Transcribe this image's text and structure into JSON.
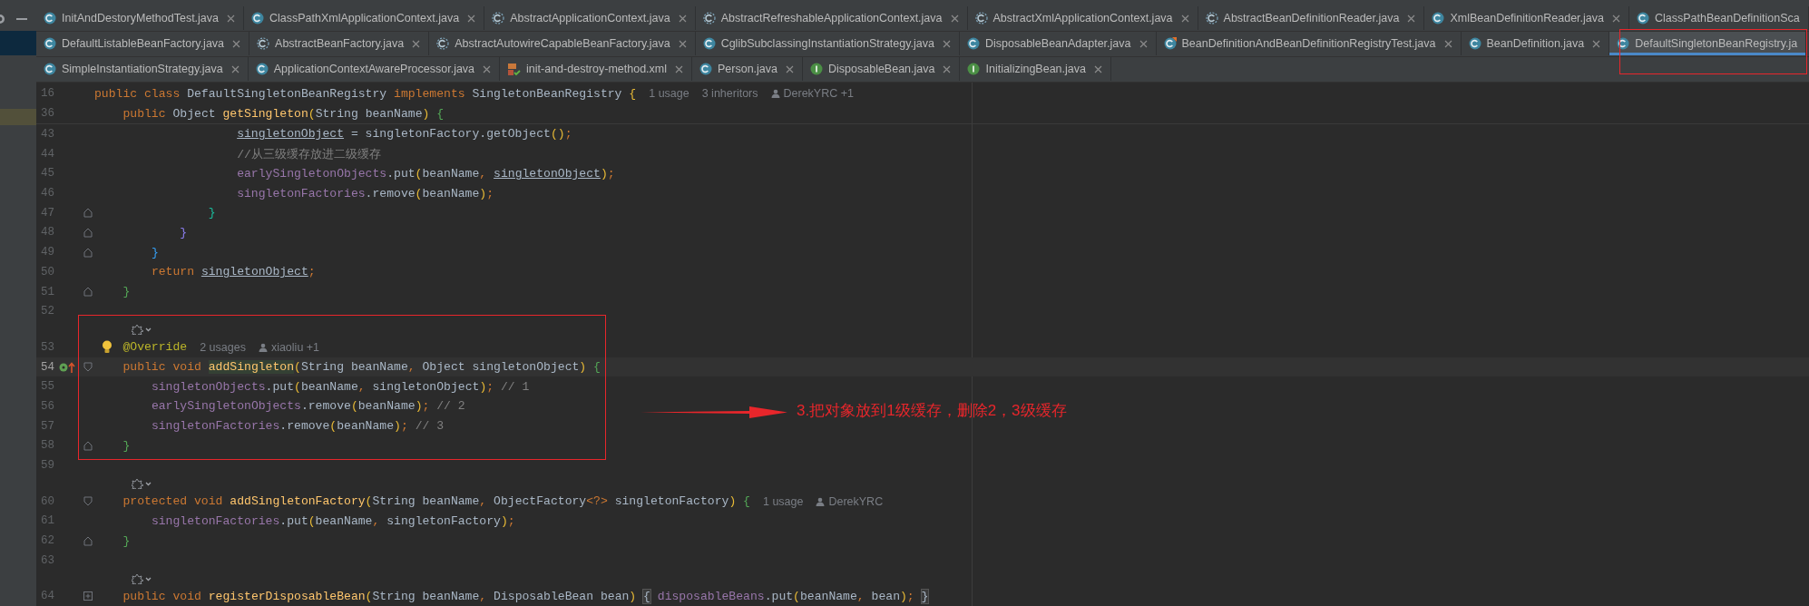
{
  "tabs": [
    [
      {
        "label": "InitAndDestoryMethodTest.java",
        "kind": "class",
        "selected": false,
        "closable": true
      },
      {
        "label": "ClassPathXmlApplicationContext.java",
        "kind": "class",
        "selected": false,
        "closable": true
      },
      {
        "label": "AbstractApplicationContext.java",
        "kind": "abstract",
        "selected": false,
        "closable": true
      },
      {
        "label": "AbstractRefreshableApplicationContext.java",
        "kind": "abstract",
        "selected": false,
        "closable": true
      },
      {
        "label": "AbstractXmlApplicationContext.java",
        "kind": "abstract",
        "selected": false,
        "closable": true
      },
      {
        "label": "AbstractBeanDefinitionReader.java",
        "kind": "abstract",
        "selected": false,
        "closable": true
      },
      {
        "label": "XmlBeanDefinitionReader.java",
        "kind": "class",
        "selected": false,
        "closable": true
      },
      {
        "label": "ClassPathBeanDefinitionSca",
        "kind": "class",
        "selected": false,
        "closable": false
      }
    ],
    [
      {
        "label": "DefaultListableBeanFactory.java",
        "kind": "class",
        "selected": false,
        "closable": true
      },
      {
        "label": "AbstractBeanFactory.java",
        "kind": "abstract",
        "selected": false,
        "closable": true
      },
      {
        "label": "AbstractAutowireCapableBeanFactory.java",
        "kind": "abstract",
        "selected": false,
        "closable": true
      },
      {
        "label": "CglibSubclassingInstantiationStrategy.java",
        "kind": "class",
        "selected": false,
        "closable": true
      },
      {
        "label": "DisposableBeanAdapter.java",
        "kind": "class",
        "selected": false,
        "closable": true
      },
      {
        "label": "BeanDefinitionAndBeanDefinitionRegistryTest.java",
        "kind": "test",
        "selected": false,
        "closable": true
      },
      {
        "label": "BeanDefinition.java",
        "kind": "class",
        "selected": false,
        "closable": true
      },
      {
        "label": "DefaultSingletonBeanRegistry.ja",
        "kind": "class",
        "selected": true,
        "closable": false
      }
    ],
    [
      {
        "label": "SimpleInstantiationStrategy.java",
        "kind": "class",
        "selected": false,
        "closable": true
      },
      {
        "label": "ApplicationContextAwareProcessor.java",
        "kind": "class",
        "selected": false,
        "closable": true
      },
      {
        "label": "init-and-destroy-method.xml",
        "kind": "xml",
        "selected": false,
        "closable": true
      },
      {
        "label": "Person.java",
        "kind": "class",
        "selected": false,
        "closable": true
      },
      {
        "label": "DisposableBean.java",
        "kind": "interface",
        "selected": false,
        "closable": true
      },
      {
        "label": "InitializingBean.java",
        "kind": "interface",
        "selected": false,
        "closable": true
      }
    ]
  ],
  "sticky": [
    {
      "number": "16",
      "tokens": [
        {
          "t": "public class ",
          "kind": "keyword"
        },
        {
          "t": "DefaultSingletonBeanRegistry ",
          "kind": "plain"
        },
        {
          "t": "implements ",
          "kind": "keyword"
        },
        {
          "t": "SingletonBeanRegistry ",
          "kind": "plain"
        },
        {
          "t": "{",
          "kind": "brace1"
        }
      ],
      "hints": [
        "1 usage",
        "3 inheritors"
      ],
      "author": "DerekYRC +1"
    },
    {
      "number": "36",
      "tokens": [
        {
          "t": "    public ",
          "kind": "keyword"
        },
        {
          "t": "Object ",
          "kind": "plain"
        },
        {
          "t": "getSingleton",
          "kind": "method"
        },
        {
          "t": "(",
          "kind": "brace1"
        },
        {
          "t": "String beanName",
          "kind": "plain"
        },
        {
          "t": ")",
          "kind": "brace1"
        },
        {
          "t": " {",
          "kind": "brace2"
        }
      ]
    }
  ],
  "lines": [
    {
      "kind": "code",
      "number": "43",
      "tokens": [
        {
          "t": "                    singletonObject",
          "kind": "local"
        },
        {
          "t": " = singletonFactory.getObject",
          "kind": "plain"
        },
        {
          "t": "()",
          "kind": "brace1"
        },
        {
          "t": ";",
          "kind": "punct"
        }
      ]
    },
    {
      "kind": "code",
      "number": "44",
      "tokens": [
        {
          "t": "                    //从三级缓存放进二级缓存",
          "kind": "comment"
        }
      ]
    },
    {
      "kind": "code",
      "number": "45",
      "tokens": [
        {
          "t": "                    earlySingletonObjects",
          "kind": "field"
        },
        {
          "t": ".put",
          "kind": "plain"
        },
        {
          "t": "(",
          "kind": "brace1"
        },
        {
          "t": "beanName",
          "kind": "plain"
        },
        {
          "t": ", ",
          "kind": "punct"
        },
        {
          "t": "singletonObject",
          "kind": "local"
        },
        {
          "t": ")",
          "kind": "brace1"
        },
        {
          "t": ";",
          "kind": "punct"
        }
      ]
    },
    {
      "kind": "code",
      "number": "46",
      "tokens": [
        {
          "t": "                    singletonFactories",
          "kind": "field"
        },
        {
          "t": ".remove",
          "kind": "plain"
        },
        {
          "t": "(",
          "kind": "brace1"
        },
        {
          "t": "beanName",
          "kind": "plain"
        },
        {
          "t": ")",
          "kind": "brace1"
        },
        {
          "t": ";",
          "kind": "punct"
        }
      ]
    },
    {
      "kind": "code",
      "number": "47",
      "fold": {
        "kind": "end"
      },
      "tokens": [
        {
          "t": "                }",
          "kind": "brace4"
        }
      ]
    },
    {
      "kind": "code",
      "number": "48",
      "fold": {
        "kind": "end"
      },
      "tokens": [
        {
          "t": "            }",
          "kind": "brace5"
        }
      ]
    },
    {
      "kind": "code",
      "number": "49",
      "fold": {
        "kind": "end"
      },
      "tokens": [
        {
          "t": "        }",
          "kind": "brace3"
        }
      ]
    },
    {
      "kind": "code",
      "number": "50",
      "tokens": [
        {
          "t": "        return ",
          "kind": "keyword"
        },
        {
          "t": "singletonObject",
          "kind": "local"
        },
        {
          "t": ";",
          "kind": "punct"
        }
      ]
    },
    {
      "kind": "code",
      "number": "51",
      "fold": {
        "kind": "end"
      },
      "tokens": [
        {
          "t": "    }",
          "kind": "brace2"
        }
      ]
    },
    {
      "kind": "code",
      "number": "52"
    },
    {
      "kind": "hint"
    },
    {
      "kind": "code",
      "number": "53",
      "gutter": {
        "kind": "bulb"
      },
      "tokens": [
        {
          "t": "    @Override",
          "kind": "annotation"
        }
      ],
      "hints": [
        "2 usages"
      ],
      "author": "xiaoliu +1"
    },
    {
      "kind": "code",
      "number": "54",
      "gutter": {
        "kind": "override"
      },
      "current": true,
      "fold": {
        "kind": "open"
      },
      "tokens": [
        {
          "t": "    public void ",
          "kind": "keyword"
        },
        {
          "t": "addSingleton",
          "kind": "method"
        },
        {
          "t": "(",
          "kind": "brace1"
        },
        {
          "t": "String beanName",
          "kind": "plain"
        },
        {
          "t": ", ",
          "kind": "punct"
        },
        {
          "t": "Object singletonObject",
          "kind": "plain"
        },
        {
          "t": ")",
          "kind": "brace1"
        },
        {
          "t": " {",
          "kind": "brace2"
        }
      ]
    },
    {
      "kind": "code",
      "number": "55",
      "tokens": [
        {
          "t": "        singletonObjects",
          "kind": "field"
        },
        {
          "t": ".put",
          "kind": "plain"
        },
        {
          "t": "(",
          "kind": "brace1"
        },
        {
          "t": "beanName",
          "kind": "plain"
        },
        {
          "t": ", ",
          "kind": "punct"
        },
        {
          "t": "singletonObject",
          "kind": "plain"
        },
        {
          "t": ")",
          "kind": "brace1"
        },
        {
          "t": ";",
          "kind": "punct"
        },
        {
          "t": " // 1",
          "kind": "comment"
        }
      ]
    },
    {
      "kind": "code",
      "number": "56",
      "tokens": [
        {
          "t": "        earlySingletonObjects",
          "kind": "field"
        },
        {
          "t": ".remove",
          "kind": "plain"
        },
        {
          "t": "(",
          "kind": "brace1"
        },
        {
          "t": "beanName",
          "kind": "plain"
        },
        {
          "t": ")",
          "kind": "brace1"
        },
        {
          "t": ";",
          "kind": "punct"
        },
        {
          "t": " // 2",
          "kind": "comment"
        }
      ]
    },
    {
      "kind": "code",
      "number": "57",
      "tokens": [
        {
          "t": "        singletonFactories",
          "kind": "field"
        },
        {
          "t": ".remove",
          "kind": "plain"
        },
        {
          "t": "(",
          "kind": "brace1"
        },
        {
          "t": "beanName",
          "kind": "plain"
        },
        {
          "t": ")",
          "kind": "brace1"
        },
        {
          "t": ";",
          "kind": "punct"
        },
        {
          "t": " // 3",
          "kind": "comment"
        }
      ]
    },
    {
      "kind": "code",
      "number": "58",
      "fold": {
        "kind": "end"
      },
      "tokens": [
        {
          "t": "    }",
          "kind": "brace2"
        }
      ]
    },
    {
      "kind": "code",
      "number": "59"
    },
    {
      "kind": "hint"
    },
    {
      "kind": "code",
      "number": "60",
      "fold": {
        "kind": "open"
      },
      "tokens": [
        {
          "t": "    protected void ",
          "kind": "keyword"
        },
        {
          "t": "addSingletonFactory",
          "kind": "method"
        },
        {
          "t": "(",
          "kind": "brace1"
        },
        {
          "t": "String beanName",
          "kind": "plain"
        },
        {
          "t": ", ",
          "kind": "punct"
        },
        {
          "t": "ObjectFactory",
          "kind": "plain"
        },
        {
          "t": "<?>",
          "kind": "punct"
        },
        {
          "t": " singletonFactory",
          "kind": "plain"
        },
        {
          "t": ")",
          "kind": "brace1"
        },
        {
          "t": " {",
          "kind": "brace2"
        }
      ],
      "hints": [
        "1 usage"
      ],
      "author": "DerekYRC"
    },
    {
      "kind": "code",
      "number": "61",
      "tokens": [
        {
          "t": "        singletonFactories",
          "kind": "field"
        },
        {
          "t": ".put",
          "kind": "plain"
        },
        {
          "t": "(",
          "kind": "brace1"
        },
        {
          "t": "beanName",
          "kind": "plain"
        },
        {
          "t": ", ",
          "kind": "punct"
        },
        {
          "t": "singletonFactory",
          "kind": "plain"
        },
        {
          "t": ")",
          "kind": "brace1"
        },
        {
          "t": ";",
          "kind": "punct"
        }
      ]
    },
    {
      "kind": "code",
      "number": "62",
      "fold": {
        "kind": "end"
      },
      "tokens": [
        {
          "t": "    }",
          "kind": "brace2"
        }
      ]
    },
    {
      "kind": "code",
      "number": "63"
    },
    {
      "kind": "hint"
    },
    {
      "kind": "code",
      "number": "64",
      "fold": {
        "kind": "folded"
      },
      "tokens": [
        {
          "t": "    public void ",
          "kind": "keyword"
        },
        {
          "t": "registerDisposableBean",
          "kind": "method"
        },
        {
          "t": "(",
          "kind": "brace1"
        },
        {
          "t": "String beanName",
          "kind": "plain"
        },
        {
          "t": ", ",
          "kind": "punct"
        },
        {
          "t": "DisposableBean bean",
          "kind": "plain"
        },
        {
          "t": ") ",
          "kind": "brace1"
        },
        {
          "t": "{",
          "kind": "folded"
        },
        {
          "t": " disposableBeans",
          "kind": "field"
        },
        {
          "t": ".put",
          "kind": "plain"
        },
        {
          "t": "(",
          "kind": "brace1"
        },
        {
          "t": "beanName",
          "kind": "plain"
        },
        {
          "t": ", ",
          "kind": "punct"
        },
        {
          "t": "bean",
          "kind": "plain"
        },
        {
          "t": ")",
          "kind": "brace1"
        },
        {
          "t": "; ",
          "kind": "punct"
        },
        {
          "t": "}",
          "kind": "folded"
        }
      ]
    }
  ],
  "annotation": {
    "note": "3.把对象放到1级缓存，删除2，3级缓存"
  }
}
